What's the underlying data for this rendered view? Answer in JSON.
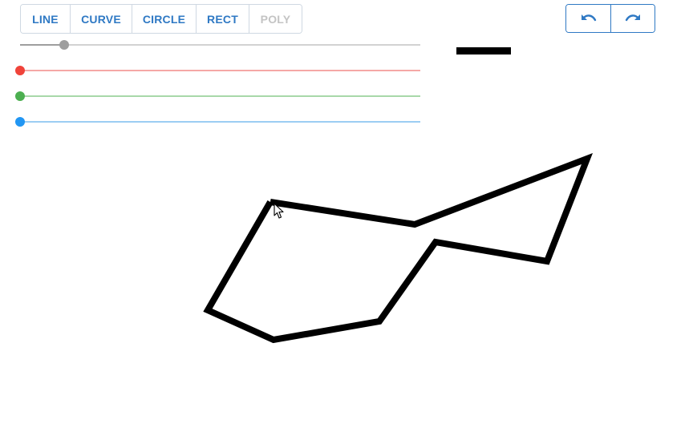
{
  "toolbar": {
    "tools": [
      {
        "label": "LINE",
        "enabled": true
      },
      {
        "label": "CURVE",
        "enabled": true
      },
      {
        "label": "CIRCLE",
        "enabled": true
      },
      {
        "label": "RECT",
        "enabled": true
      },
      {
        "label": "POLY",
        "enabled": false
      }
    ],
    "accent_color": "#2f79c4",
    "disabled_color": "#c4c4c4"
  },
  "history": {
    "undo_icon": "undo-icon",
    "redo_icon": "redo-icon"
  },
  "sliders": {
    "stroke_width": {
      "value_fraction": 0.11,
      "color": "#9e9e9e"
    },
    "red": {
      "value_fraction": 0.0,
      "color": "#f0433a"
    },
    "green": {
      "value_fraction": 0.0,
      "color": "#4caf50"
    },
    "blue": {
      "value_fraction": 0.0,
      "color": "#2196f3"
    }
  },
  "stroke_preview": {
    "color": "#000000"
  },
  "drawing": {
    "shape": "polygon",
    "stroke_color": "#000000"
  }
}
